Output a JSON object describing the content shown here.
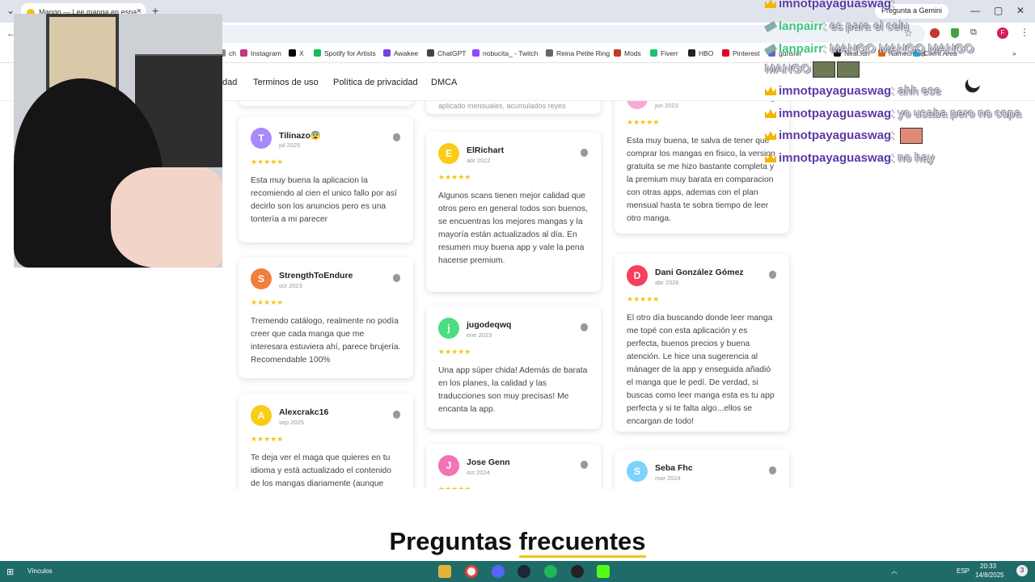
{
  "browser": {
    "tab_title": "Mango — Lee manga en espa",
    "gemini_label": "Pregunta a Gemini",
    "bookmarks": [
      "ch",
      "Instagram",
      "X",
      "Spotify for Artists",
      "Awakee",
      "ChatGPT",
      "nobucita_ - Twitch",
      "Reina Petite Ring",
      "Mods",
      "Fiverr",
      "HBO",
      "Pinterest",
      "gunsfor",
      "Neal.fun",
      "Namecheap",
      "Client Area"
    ]
  },
  "site_nav": {
    "links": [
      "dad",
      "Terminos de uso",
      "Política de privacidad",
      "DMCA"
    ]
  },
  "reviews": [
    {
      "initial": "T",
      "name": "Tilinazo😨",
      "date": "jul 2025",
      "stars": "★★★★★",
      "text": "Esta muy buena la aplicacion la recomiendo al cien el unico fallo por así decirlo son los anuncios pero es una tontería a mi parecer",
      "color": "#a78bfa"
    },
    {
      "initial": "S",
      "name": "StrengthToEndure",
      "date": "oct 2023",
      "stars": "★★★★★",
      "text": "Tremendo catálogo, realmente no podía creer que cada manga que me interesara estuviera ahí, parece brujería. Recomendable 100%",
      "color": "#f0803c"
    },
    {
      "initial": "A",
      "name": "Alexcrakc16",
      "date": "sep 2025",
      "stars": "★★★★★",
      "text": "Te deja ver el maga que quieres en tu idioma y está actualizado el contenido de los mangas diariamente (aunque",
      "color": "#facc15"
    },
    {
      "initial": "E",
      "name": "ElRichart",
      "date": "abr 2022",
      "stars": "★★★★★",
      "text": "Algunos scans tienen mejor calidad que otros pero en general todos son buenos, se encuentras los mejores mangas y la mayoría están actualizados al día. En resumen muy buena app y vale la pena hacerse premium.",
      "color": "#facc15"
    },
    {
      "initial": "j",
      "name": "jugodeqwq",
      "date": "ene 2023",
      "stars": "★★★★★",
      "text": "Una app súper chida! Además de barata en los planes, la calidad y las traducciones son muy precisas! Me encanta la app.",
      "color": "#4ade80"
    },
    {
      "initial": "J",
      "name": "Jose Genn",
      "date": "oct 2024",
      "stars": "★★★★★",
      "text": "",
      "color": "#f472b6"
    },
    {
      "initial": "",
      "name": "",
      "date": "jun 2023",
      "stars": "★★★★★",
      "text": "Esta muy buena, te salva de tener que comprar los mangas en fisico, la version gratuita se me hizo bastante completa y la premium muy barata en comparacion con otras apps, ademas con el plan mensual hasta te sobra tiempo de leer otro manga.",
      "color": "#f9a8d4"
    },
    {
      "initial": "D",
      "name": "Dani González Gómez",
      "date": "abr 2026",
      "stars": "★★★★★",
      "text": "El otro día buscando donde leer manga me topé con esta aplicación y es perfecta, buenos precios y buena atención. Le hice una sugerencia al mánager de la app y enseguida añadió el manga que le pedí. De verdad, si buscas como leer manga esta es tu app perfecta y si te falta algo...ellos se encargan de todo!",
      "color": "#f43f5e"
    },
    {
      "initial": "S",
      "name": "Seba Fhc",
      "date": "mar 2024",
      "stars": "",
      "text": "",
      "color": "#7dd3fc"
    }
  ],
  "partial_texts": {
    "top_middle": "aplicado mensuales, acumulados reyes"
  },
  "faq": {
    "word1": "Preguntas",
    "word2": "frecuentes"
  },
  "chat": [
    {
      "user": "imnotpayaguaswag",
      "msg": "",
      "badge": "crown"
    },
    {
      "user": "lanpairr",
      "msg": "es para el celu",
      "badge": "sword"
    },
    {
      "user": "lanpairr",
      "msg": "MANGO MANGO MANGO",
      "badge": "sword"
    },
    {
      "user": "",
      "msg": "MANGO",
      "badge": ""
    },
    {
      "user": "imnotpayaguaswag",
      "msg": "ahh ese",
      "badge": "crown"
    },
    {
      "user": "imnotpayaguaswag",
      "msg": "yo usaba pero no copa",
      "badge": "crown"
    },
    {
      "user": "imnotpayaguaswag",
      "msg": "",
      "badge": "crown"
    },
    {
      "user": "imnotpayaguaswag",
      "msg": "no hay",
      "badge": "crown"
    }
  ],
  "taskbar": {
    "vinculos": "Vínculos",
    "lang": "ESP",
    "time": "20:33",
    "date": "14/8/2025",
    "notif": "3"
  }
}
